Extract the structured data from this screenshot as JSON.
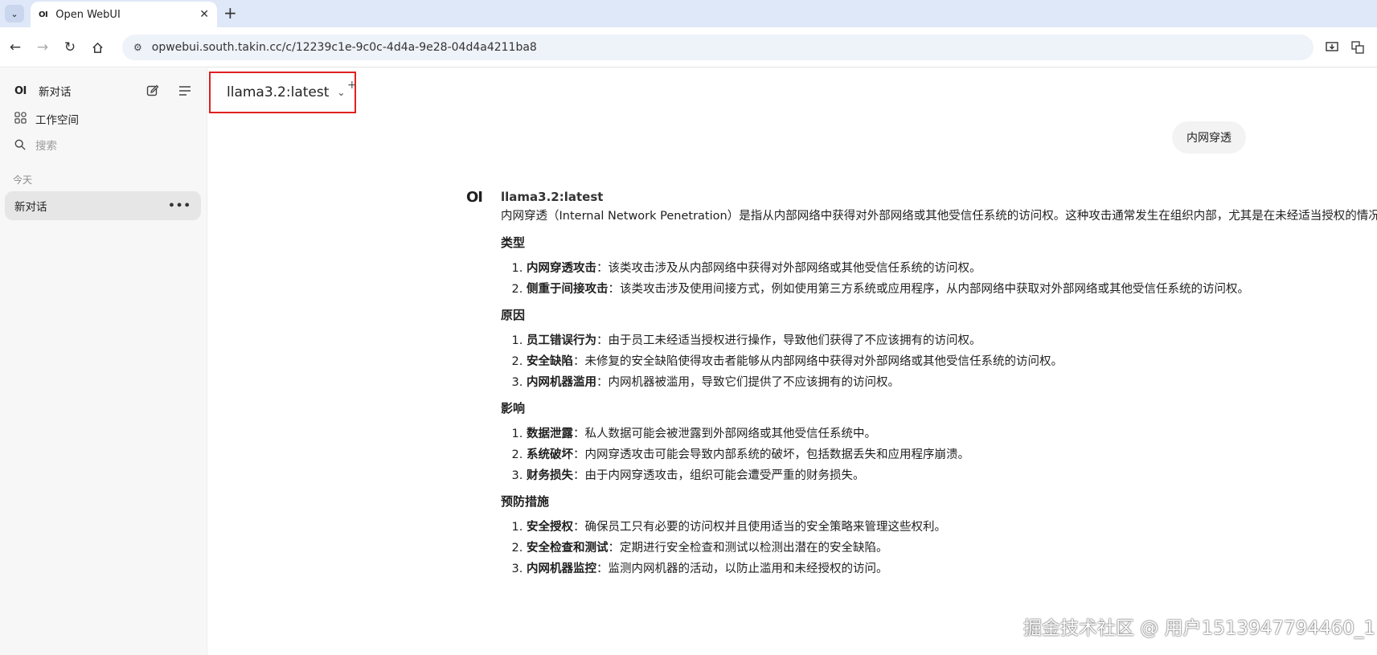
{
  "browser": {
    "tab_title": "Open WebUI",
    "tab_favicon": "OI",
    "url": "opwebui.south.takin.cc/c/12239c1e-9c0c-4d4a-9e28-04d4a4211ba8"
  },
  "sidebar": {
    "logo": "OI",
    "new_chat": "新对话",
    "workspace": "工作空间",
    "search_placeholder": "搜索",
    "section_today": "今天",
    "chats": [
      {
        "title": "新对话"
      }
    ]
  },
  "main": {
    "model_selector": "llama3.2:latest",
    "user_message": "内网穿透",
    "assistant": {
      "avatar": "OI",
      "model": "llama3.2:latest",
      "intro": "内网穿透（Internal Network Penetration）是指从内部网络中获得对外部网络或其他受信任系统的访问权。这种攻击通常发生在组织内部，尤其是在未经适当授权的情况下。",
      "sections": [
        {
          "heading": "类型",
          "items": [
            {
              "title": "内网穿透攻击",
              "text": "：该类攻击涉及从内部网络中获得对外部网络或其他受信任系统的访问权。"
            },
            {
              "title": "侧重于间接攻击",
              "text": "：该类攻击涉及使用间接方式，例如使用第三方系统或应用程序，从内部网络中获取对外部网络或其他受信任系统的访问权。"
            }
          ]
        },
        {
          "heading": "原因",
          "items": [
            {
              "title": "员工错误行为",
              "text": "：由于员工未经适当授权进行操作，导致他们获得了不应该拥有的访问权。"
            },
            {
              "title": "安全缺陷",
              "text": "：未修复的安全缺陷使得攻击者能够从内部网络中获得对外部网络或其他受信任系统的访问权。"
            },
            {
              "title": "内网机器滥用",
              "text": "：内网机器被滥用，导致它们提供了不应该拥有的访问权。"
            }
          ]
        },
        {
          "heading": "影响",
          "items": [
            {
              "title": "数据泄露",
              "text": "：私人数据可能会被泄露到外部网络或其他受信任系统中。"
            },
            {
              "title": "系统破坏",
              "text": "：内网穿透攻击可能会导致内部系统的破坏，包括数据丢失和应用程序崩溃。"
            },
            {
              "title": "财务损失",
              "text": "：由于内网穿透攻击，组织可能会遭受严重的财务损失。"
            }
          ]
        },
        {
          "heading": "预防措施",
          "items": [
            {
              "title": "安全授权",
              "text": "：确保员工只有必要的访问权并且使用适当的安全策略来管理这些权利。"
            },
            {
              "title": "安全检查和测试",
              "text": "：定期进行安全检查和测试以检测出潜在的安全缺陷。"
            },
            {
              "title": "内网机器监控",
              "text": "：监测内网机器的活动，以防止滥用和未经授权的访问。"
            }
          ]
        }
      ]
    }
  },
  "watermark": "掘金技术社区 @ 用户1513947794460_1",
  "icons": [
    "chevron-down-icon",
    "close-icon",
    "plus-icon",
    "back-icon",
    "forward-icon",
    "reload-icon",
    "home-icon",
    "site-info-icon",
    "install-icon",
    "translate-icon",
    "edit-icon",
    "menu-icon",
    "workspace-icon",
    "search-icon",
    "more-icon"
  ]
}
